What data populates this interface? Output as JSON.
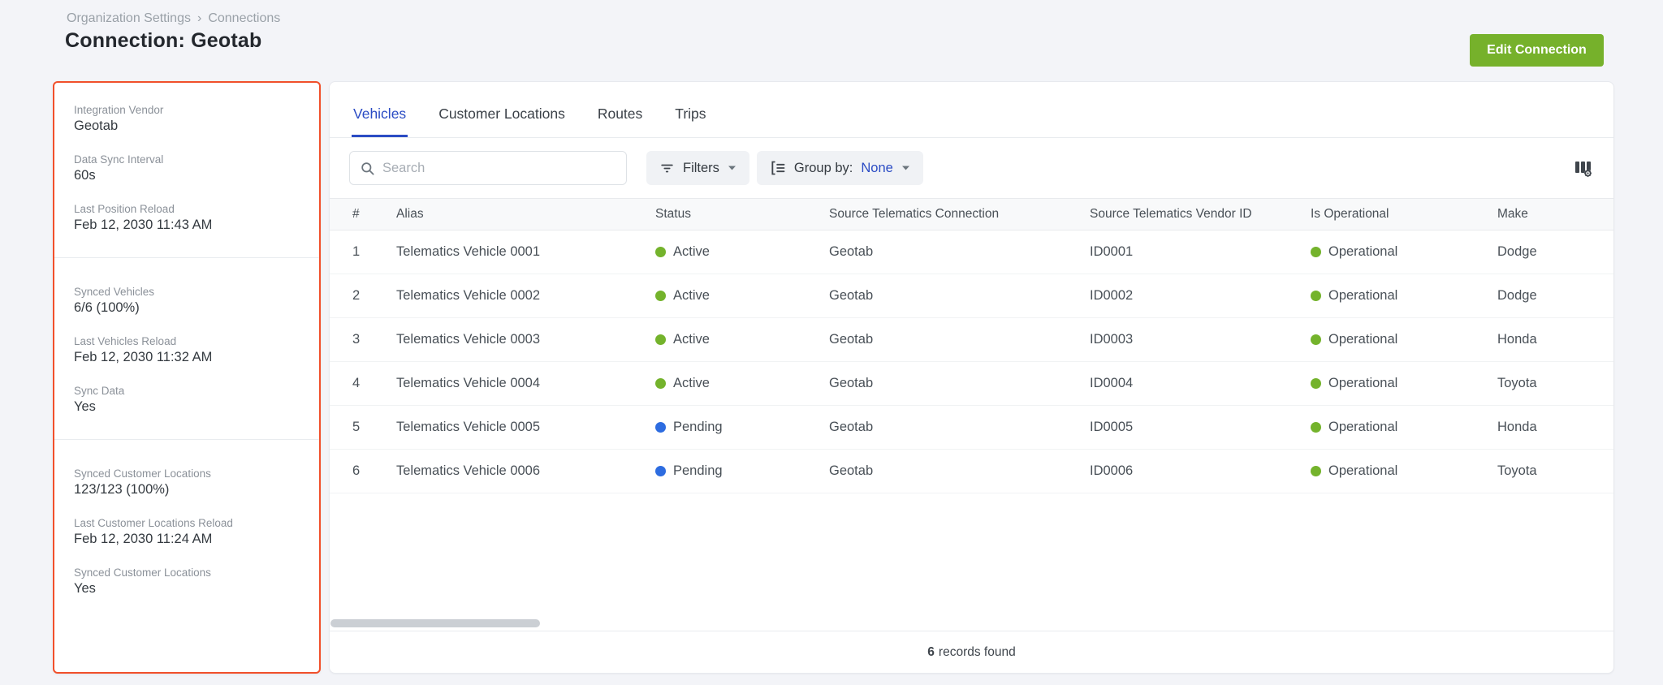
{
  "colors": {
    "accent_green": "#76b12b",
    "active_blue": "#2b4cc4",
    "pending_blue": "#2d6ce0",
    "operational_green": "#74b32c",
    "panel_border_red": "#f1502b"
  },
  "breadcrumb": {
    "items": [
      "Organization Settings",
      "Connections"
    ],
    "separator": "›"
  },
  "header": {
    "title": "Connection: Geotab",
    "edit_button": "Edit Connection"
  },
  "sidebar": {
    "sections": [
      {
        "fields": [
          {
            "label": "Integration Vendor",
            "value": "Geotab"
          },
          {
            "label": "Data Sync Interval",
            "value": "60s"
          },
          {
            "label": "Last Position Reload",
            "value": "Feb 12, 2030 11:43 AM"
          }
        ]
      },
      {
        "fields": [
          {
            "label": "Synced Vehicles",
            "value": "6/6 (100%)"
          },
          {
            "label": "Last Vehicles Reload",
            "value": "Feb 12, 2030 11:32 AM"
          },
          {
            "label": "Sync Data",
            "value": "Yes"
          }
        ]
      },
      {
        "fields": [
          {
            "label": "Synced Customer Locations",
            "value": "123/123 (100%)"
          },
          {
            "label": "Last Customer Locations Reload",
            "value": "Feb 12, 2030 11:24 AM"
          },
          {
            "label": "Synced Customer Locations",
            "value": "Yes"
          }
        ]
      }
    ]
  },
  "tabs": [
    {
      "label": "Vehicles"
    },
    {
      "label": "Customer Locations"
    },
    {
      "label": "Routes"
    },
    {
      "label": "Trips"
    }
  ],
  "toolbar": {
    "search_placeholder": "Search",
    "filters_label": "Filters",
    "group_by_label": "Group by:",
    "group_by_value": "None"
  },
  "table": {
    "columns": [
      "#",
      "Alias",
      "Status",
      "Source Telematics Connection",
      "Source Telematics Vendor ID",
      "Is Operational",
      "Make"
    ],
    "rows": [
      {
        "num": "1",
        "alias": "Telematics Vehicle 0001",
        "status": "Active",
        "status_color": "green",
        "connection": "Geotab",
        "vendor_id": "ID0001",
        "operational": "Operational",
        "operational_color": "green",
        "make": "Dodge"
      },
      {
        "num": "2",
        "alias": "Telematics Vehicle 0002",
        "status": "Active",
        "status_color": "green",
        "connection": "Geotab",
        "vendor_id": "ID0002",
        "operational": "Operational",
        "operational_color": "green",
        "make": "Dodge"
      },
      {
        "num": "3",
        "alias": "Telematics Vehicle 0003",
        "status": "Active",
        "status_color": "green",
        "connection": "Geotab",
        "vendor_id": "ID0003",
        "operational": "Operational",
        "operational_color": "green",
        "make": "Honda"
      },
      {
        "num": "4",
        "alias": "Telematics Vehicle 0004",
        "status": "Active",
        "status_color": "green",
        "connection": "Geotab",
        "vendor_id": "ID0004",
        "operational": "Operational",
        "operational_color": "green",
        "make": "Toyota"
      },
      {
        "num": "5",
        "alias": "Telematics Vehicle 0005",
        "status": "Pending",
        "status_color": "blue",
        "connection": "Geotab",
        "vendor_id": "ID0005",
        "operational": "Operational",
        "operational_color": "green",
        "make": "Honda"
      },
      {
        "num": "6",
        "alias": "Telematics Vehicle 0006",
        "status": "Pending",
        "status_color": "blue",
        "connection": "Geotab",
        "vendor_id": "ID0006",
        "operational": "Operational",
        "operational_color": "green",
        "make": "Toyota"
      }
    ]
  },
  "footer": {
    "count": "6",
    "text": "records found"
  }
}
